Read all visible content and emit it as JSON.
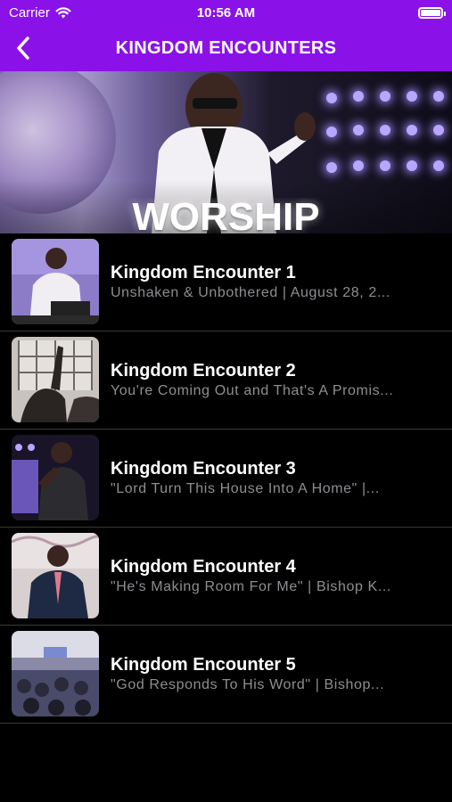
{
  "status": {
    "carrier": "Carrier",
    "time": "10:56 AM",
    "battery_level": 1.0
  },
  "nav": {
    "title": "KINGDOM ENCOUNTERS",
    "back_icon": "chevron-left-icon"
  },
  "hero": {
    "label": "WORSHIP"
  },
  "colors": {
    "accent": "#8a12e8",
    "background": "#000000",
    "subtitle": "#8e8e93",
    "divider": "#3a3a3c"
  },
  "items": [
    {
      "title": "Kingdom Encounter 1",
      "subtitle": "Unshaken & Unbothered | August 28, 2..."
    },
    {
      "title": "Kingdom Encounter 2",
      "subtitle": "You're Coming Out and That's A Promis..."
    },
    {
      "title": "Kingdom Encounter 3",
      "subtitle": "\"Lord Turn This House Into A Home\" |..."
    },
    {
      "title": "Kingdom Encounter 4",
      "subtitle": "\"He's Making Room For Me\" |  Bishop K..."
    },
    {
      "title": "Kingdom Encounter 5",
      "subtitle": "\"God Responds To His Word\" |  Bishop..."
    }
  ]
}
